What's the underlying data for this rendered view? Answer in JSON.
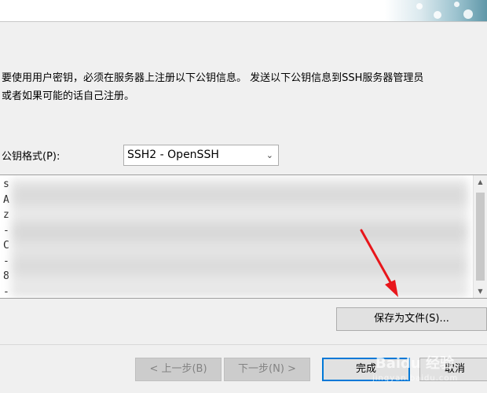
{
  "description": {
    "line1": "要使用用户密钥，必须在服务器上注册以下公钥信息。 发送以下公钥信息到SSH服务器管理员",
    "line2": "或者如果可能的话自己注册。"
  },
  "format": {
    "label": "公钥格式(P):",
    "selected": "SSH2 - OpenSSH"
  },
  "key_text": {
    "lines": [
      "s",
      "A",
      "z",
      "-",
      "C",
      "-",
      "8",
      "-"
    ]
  },
  "buttons": {
    "save": "保存为文件(S)...",
    "back": "< 上一步(B)",
    "next": "下一步(N) >",
    "finish": "完成",
    "cancel": "取消"
  },
  "watermark": {
    "text": "Baidu 经验",
    "url": "jingyan.baidu.com"
  },
  "colors": {
    "annotation_arrow": "#e8161b",
    "focus_border": "#0078d7"
  }
}
